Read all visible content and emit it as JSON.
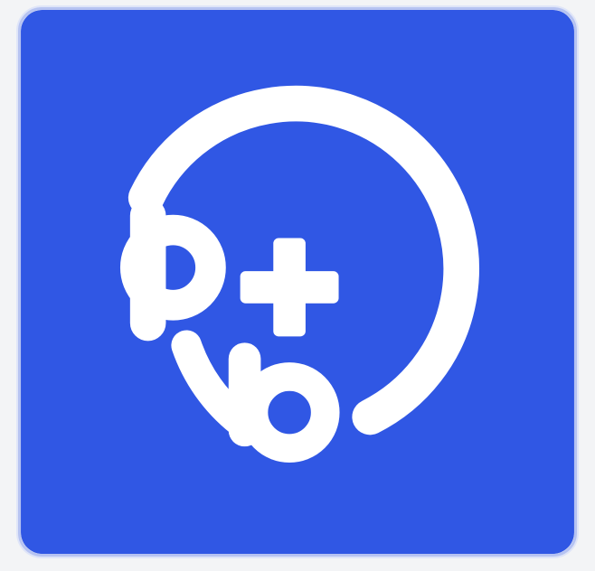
{
  "app_icon": {
    "icon": "peer-add-icon",
    "colors": {
      "background": "#3057e4",
      "glyph": "#ffffff",
      "tile_border": "#b6c3f2"
    }
  }
}
